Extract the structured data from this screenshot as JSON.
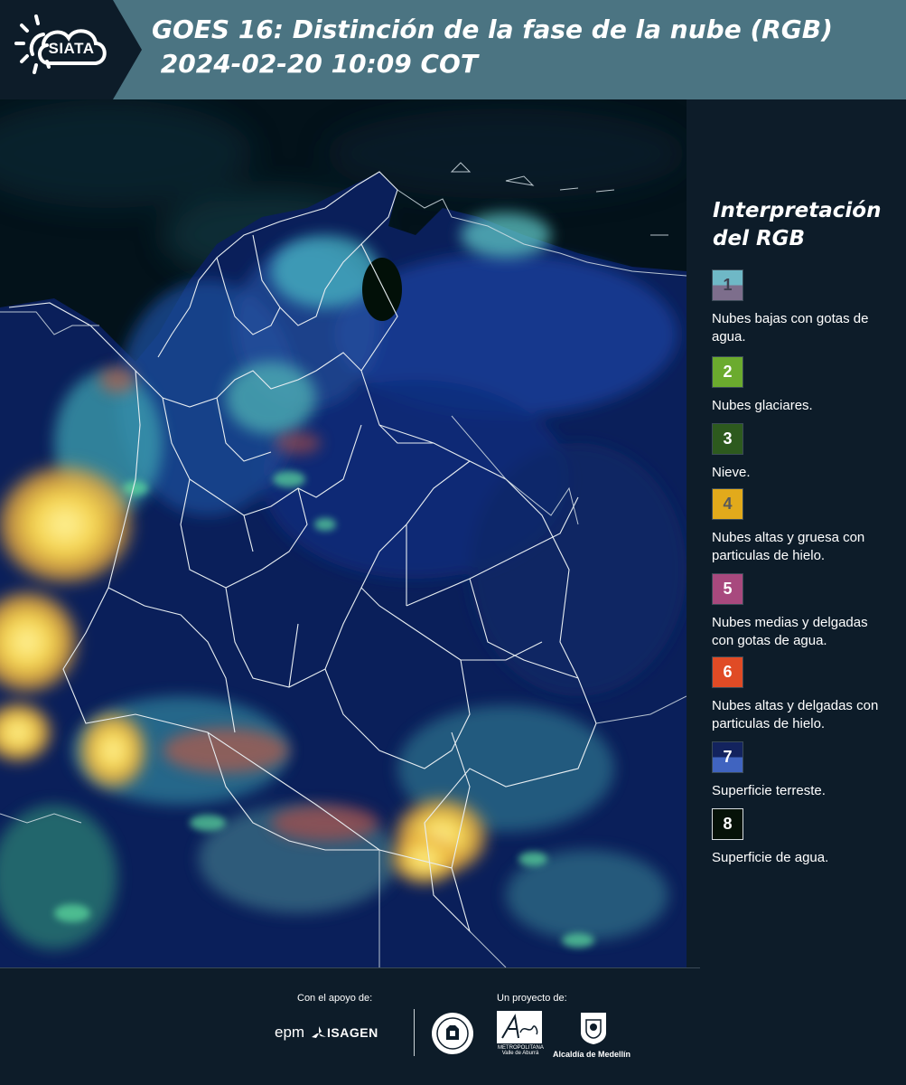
{
  "header": {
    "logo_text": "SIATA",
    "title_line1": "GOES 16: Distinción de la fase de la nube (RGB)",
    "title_line2": " 2024-02-20 10:09 COT"
  },
  "legend": {
    "title": "Interpretación del RGB",
    "items": [
      {
        "number": "1",
        "label": "Nubes bajas con gotas de agua.",
        "color_top": "#6fb8c6",
        "color_bottom": "#7d6e8c",
        "number_color": "#3f3f4f"
      },
      {
        "number": "2",
        "label": "Nubes glaciares.",
        "color_top": "#6bab2e",
        "color_bottom": "#6bab2e",
        "number_color": "#ffffff"
      },
      {
        "number": "3",
        "label": "Nieve.",
        "color_top": "#2d5a1e",
        "color_bottom": "#2d5a1e",
        "number_color": "#ffffff"
      },
      {
        "number": "4",
        "label": "Nubes altas y gruesa con particulas de hielo.",
        "color_top": "#e2aa1b",
        "color_bottom": "#e2aa1b",
        "number_color": "#5a5a5a"
      },
      {
        "number": "5",
        "label": "Nubes medias y delgadas con gotas de agua.",
        "color_top": "#a8497e",
        "color_bottom": "#a8497e",
        "number_color": "#ffffff"
      },
      {
        "number": "6",
        "label": "Nubes altas y delgadas con particulas de hielo.",
        "color_top": "#e04b25",
        "color_bottom": "#e04b25",
        "number_color": "#ffffff"
      },
      {
        "number": "7",
        "label": "Superficie terreste.",
        "color_top": "#13235e",
        "color_bottom": "#4064c0",
        "number_color": "#ffffff"
      },
      {
        "number": "8",
        "label": "Superficie de agua.",
        "color_top": "#061208",
        "color_bottom": "#061208",
        "number_color": "#ffffff"
      }
    ]
  },
  "footer": {
    "support_label": "Con el apoyo de:",
    "project_label": "Un proyecto de:",
    "sponsor1": "epm",
    "sponsor2": "ISAGEN",
    "area_text": "METROPOLITANA Valle de Aburrá",
    "alcaldia": "Alcaldía de Medellín"
  },
  "colors": {
    "header_bg": "#4b7482",
    "panel_bg": "#0d1c29"
  }
}
